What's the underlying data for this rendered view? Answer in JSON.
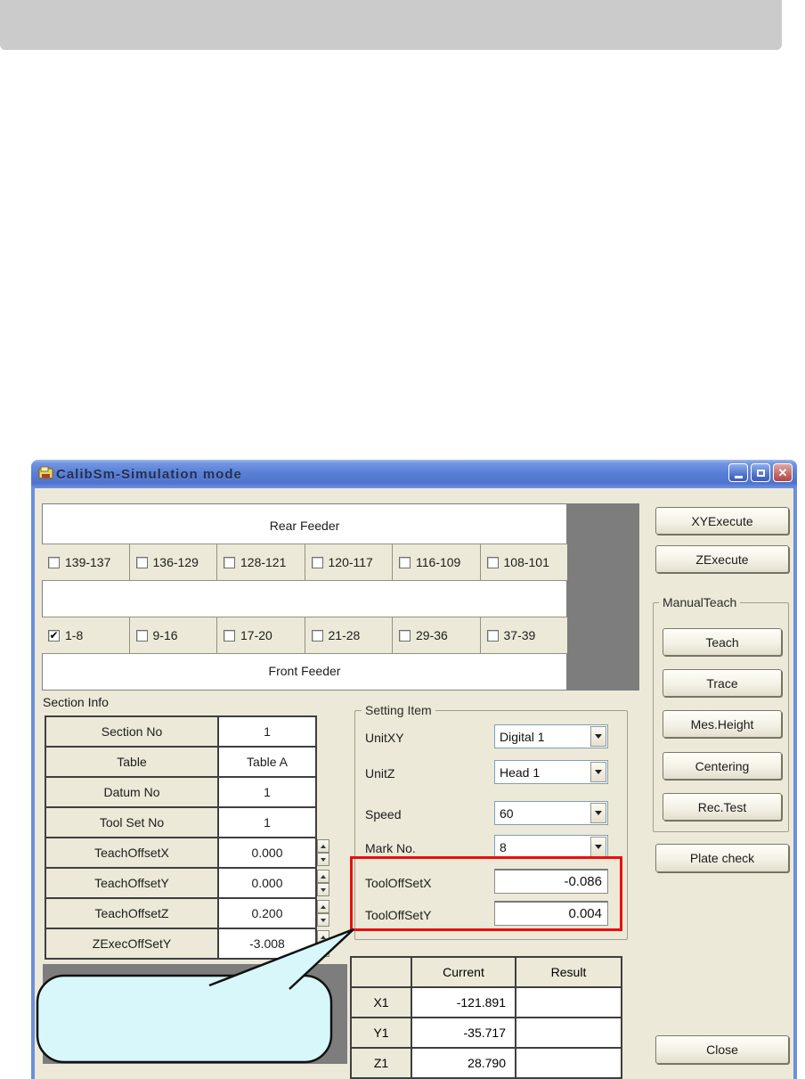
{
  "titlebar": {
    "title": "CalibSm-Simulation mode",
    "close_glyph": "✕"
  },
  "feeder": {
    "rear_label": "Rear Feeder",
    "front_label": "Front Feeder",
    "rear_items": [
      {
        "label": "139-137",
        "check": ""
      },
      {
        "label": "136-129",
        "check": ""
      },
      {
        "label": "128-121",
        "check": ""
      },
      {
        "label": "120-117",
        "check": ""
      },
      {
        "label": "116-109",
        "check": ""
      },
      {
        "label": "108-101",
        "check": ""
      }
    ],
    "front_items": [
      {
        "label": "1-8",
        "check": "✔"
      },
      {
        "label": "9-16",
        "check": ""
      },
      {
        "label": "17-20",
        "check": ""
      },
      {
        "label": "21-28",
        "check": ""
      },
      {
        "label": "29-36",
        "check": ""
      },
      {
        "label": "37-39",
        "check": ""
      }
    ]
  },
  "actions": {
    "xy_execute": "XYExecute",
    "z_execute": "ZExecute",
    "manual_teach": "ManualTeach",
    "teach": "Teach",
    "trace": "Trace",
    "mes_height": "Mes.Height",
    "centering": "Centering",
    "rec_test": "Rec.Test",
    "plate_check": "Plate check",
    "close": "Close"
  },
  "section_info": {
    "title": "Section Info",
    "rows": [
      {
        "label": "Section No",
        "value": "1"
      },
      {
        "label": "Table",
        "value": "Table A"
      },
      {
        "label": "Datum No",
        "value": "1"
      },
      {
        "label": "Tool Set No",
        "value": "1"
      },
      {
        "label": "TeachOffsetX",
        "value": "0.000"
      },
      {
        "label": "TeachOffsetY",
        "value": "0.000"
      },
      {
        "label": "TeachOffsetZ",
        "value": "0.200"
      },
      {
        "label": "ZExecOffSetY",
        "value": "-3.008"
      }
    ]
  },
  "setting_item": {
    "title": "Setting Item",
    "unit_xy": {
      "label": "UnitXY",
      "value": "Digital 1"
    },
    "unit_z": {
      "label": "UnitZ",
      "value": "Head 1"
    },
    "speed": {
      "label": "Speed",
      "value": "60"
    },
    "mark_no": {
      "label": "Mark No.",
      "value": "8"
    },
    "tool_offset_x": {
      "label": "ToolOffSetX",
      "value": "-0.086"
    },
    "tool_offset_y": {
      "label": "ToolOffSetY",
      "value": "0.004"
    }
  },
  "position_table": {
    "col_current": "Current",
    "col_result": "Result",
    "rows": [
      {
        "name": "X1",
        "current": "-121.891",
        "result": ""
      },
      {
        "name": "Y1",
        "current": "-35.717",
        "result": ""
      },
      {
        "name": "Z1",
        "current": "28.790",
        "result": ""
      }
    ]
  },
  "highlight": {
    "color": "#e8100c"
  }
}
